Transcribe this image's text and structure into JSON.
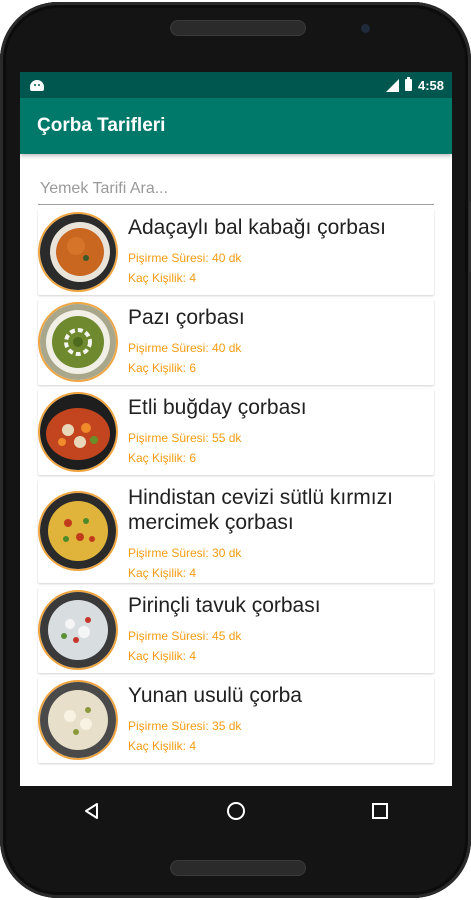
{
  "status_bar": {
    "time": "4:58"
  },
  "app_bar": {
    "title": "Çorba Tarifleri"
  },
  "search": {
    "placeholder": "Yemek Tarifi Ara..."
  },
  "recipes": [
    {
      "title": "Adaçaylı bal kabağı çorbası",
      "time": "Pişirme Süresi: 40 dk",
      "servings": "Kaç Kişilik: 4"
    },
    {
      "title": "Pazı çorbası",
      "time": "Pişirme Süresi: 40 dk",
      "servings": "Kaç Kişilik: 6"
    },
    {
      "title": "Etli buğday çorbası",
      "time": "Pişirme Süresi: 55 dk",
      "servings": "Kaç Kişilik: 6"
    },
    {
      "title": "Hindistan cevizi sütlü kırmızı mercimek çorbası",
      "time": "Pişirme Süresi: 30 dk",
      "servings": "Kaç Kişilik: 4"
    },
    {
      "title": "Pirinçli tavuk çorbası",
      "time": "Pişirme Süresi: 45 dk",
      "servings": "Kaç Kişilik: 4"
    },
    {
      "title": "Yunan usulü çorba",
      "time": "Pişirme Süresi: 35 dk",
      "servings": "Kaç Kişilik: 4"
    }
  ],
  "icons": {
    "status_left": "android-icon",
    "status_signal": "signal-icon",
    "status_battery": "battery-icon",
    "nav_back": "back-triangle-icon",
    "nav_home": "home-circle-icon",
    "nav_recents": "recents-square-icon"
  },
  "colors": {
    "status_bar": "#00574f",
    "app_bar": "#00796b",
    "meta_text": "#f39c12",
    "thumb_border": "#f0a640"
  }
}
